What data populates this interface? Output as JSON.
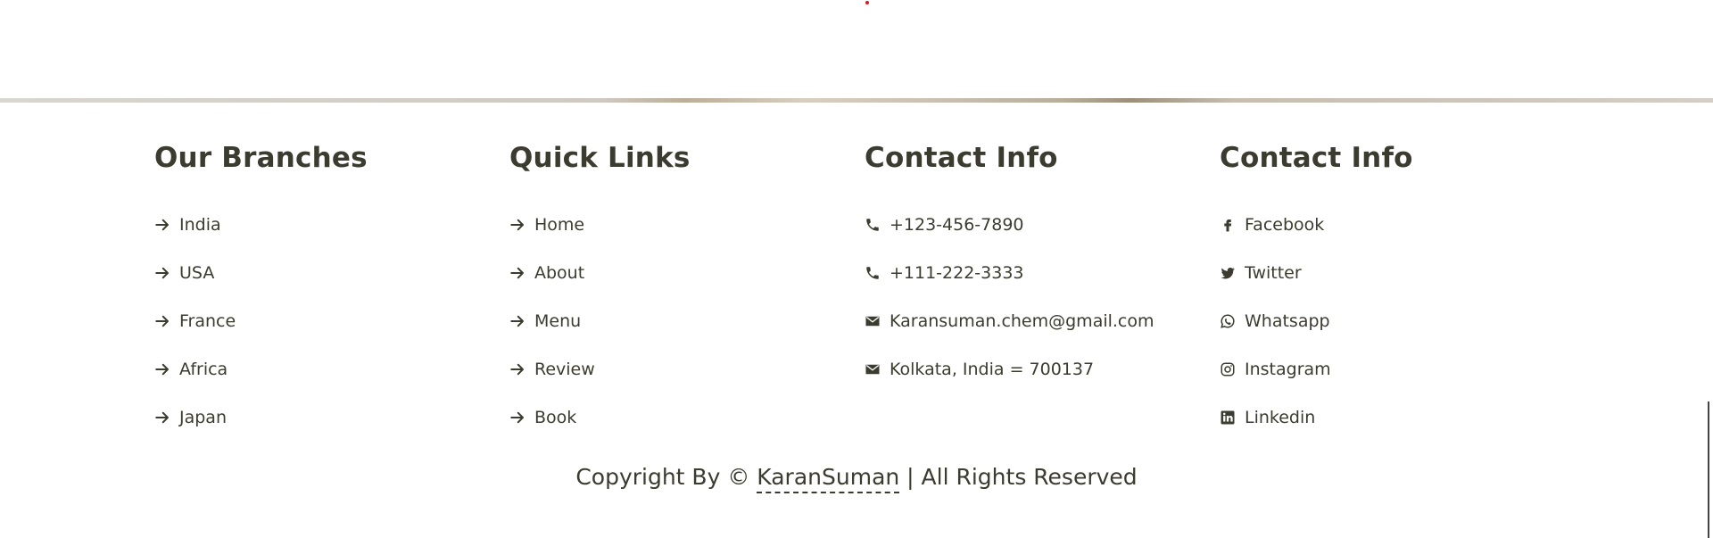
{
  "colors": {
    "text": "#3c3b30",
    "accent_dot": "#e0141e"
  },
  "footer": {
    "branches": {
      "title": "Our Branches",
      "items": [
        {
          "label": "India",
          "icon": "arrow-right-icon"
        },
        {
          "label": "USA",
          "icon": "arrow-right-icon"
        },
        {
          "label": "France",
          "icon": "arrow-right-icon"
        },
        {
          "label": "Africa",
          "icon": "arrow-right-icon"
        },
        {
          "label": "Japan",
          "icon": "arrow-right-icon"
        }
      ]
    },
    "quick_links": {
      "title": "Quick Links",
      "items": [
        {
          "label": "Home",
          "icon": "arrow-right-icon"
        },
        {
          "label": "About",
          "icon": "arrow-right-icon"
        },
        {
          "label": "Menu",
          "icon": "arrow-right-icon"
        },
        {
          "label": "Review",
          "icon": "arrow-right-icon"
        },
        {
          "label": "Book",
          "icon": "arrow-right-icon"
        }
      ]
    },
    "contact": {
      "title": "Contact Info",
      "items": [
        {
          "label": "+123-456-7890",
          "icon": "phone-icon"
        },
        {
          "label": "+111-222-3333",
          "icon": "phone-icon"
        },
        {
          "label": "Karansuman.chem@gmail.com",
          "icon": "envelope-icon"
        },
        {
          "label": "Kolkata, India = 700137",
          "icon": "envelope-icon"
        }
      ]
    },
    "social": {
      "title": "Contact Info",
      "items": [
        {
          "label": "Facebook",
          "icon": "facebook-icon"
        },
        {
          "label": "Twitter",
          "icon": "twitter-icon"
        },
        {
          "label": "Whatsapp",
          "icon": "whatsapp-icon"
        },
        {
          "label": "Instagram",
          "icon": "instagram-icon"
        },
        {
          "label": "Linkedin",
          "icon": "linkedin-icon"
        }
      ]
    },
    "copyright": {
      "prefix": "Copyright By © ",
      "author": "KaranSuman",
      "suffix": " | All Rights Reserved"
    }
  }
}
